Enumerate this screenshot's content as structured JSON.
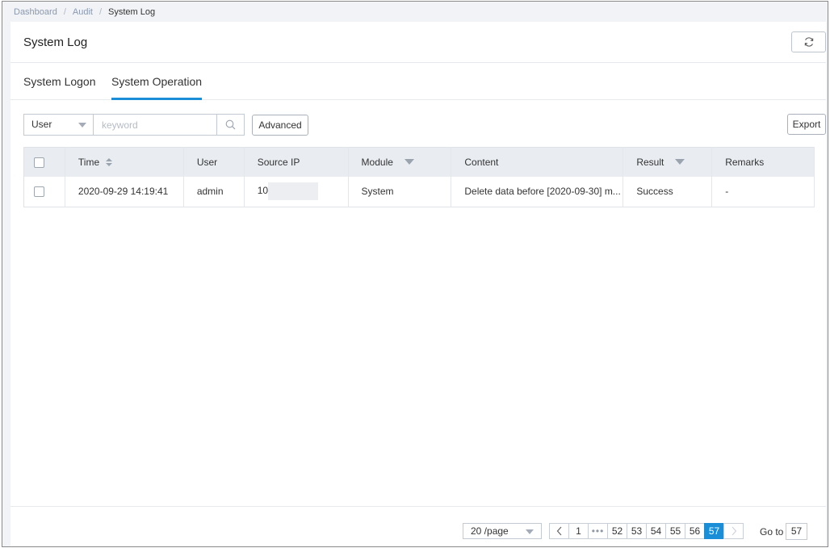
{
  "breadcrumb": {
    "items": [
      "Dashboard",
      "Audit",
      "System Log"
    ]
  },
  "header": {
    "title": "System Log",
    "refresh_icon": "refresh-icon"
  },
  "tabs": [
    {
      "label": "System Logon",
      "active": false
    },
    {
      "label": "System Operation",
      "active": true
    }
  ],
  "toolbar": {
    "search_field_select": "User",
    "keyword_placeholder": "keyword",
    "keyword_value": "",
    "advanced_label": "Advanced",
    "export_label": "Export"
  },
  "table": {
    "columns": [
      "Time",
      "User",
      "Source IP",
      "Module",
      "Content",
      "Result",
      "Remarks"
    ],
    "rows": [
      {
        "time": "2020-09-29 14:19:41",
        "user": "admin",
        "source_ip": "10.",
        "module": "System",
        "content": "Delete data before [2020-09-30] m...",
        "result": "Success",
        "remarks": "-"
      }
    ]
  },
  "pagination": {
    "page_size": "20 /page",
    "pages": [
      "1",
      "•••",
      "52",
      "53",
      "54",
      "55",
      "56",
      "57"
    ],
    "current_page": "57",
    "goto_label": "Go to",
    "goto_value": "57"
  },
  "colors": {
    "accent": "#1a8fd8",
    "header_bg": "#e9edf2",
    "page_bg": "#f1f3f6"
  }
}
